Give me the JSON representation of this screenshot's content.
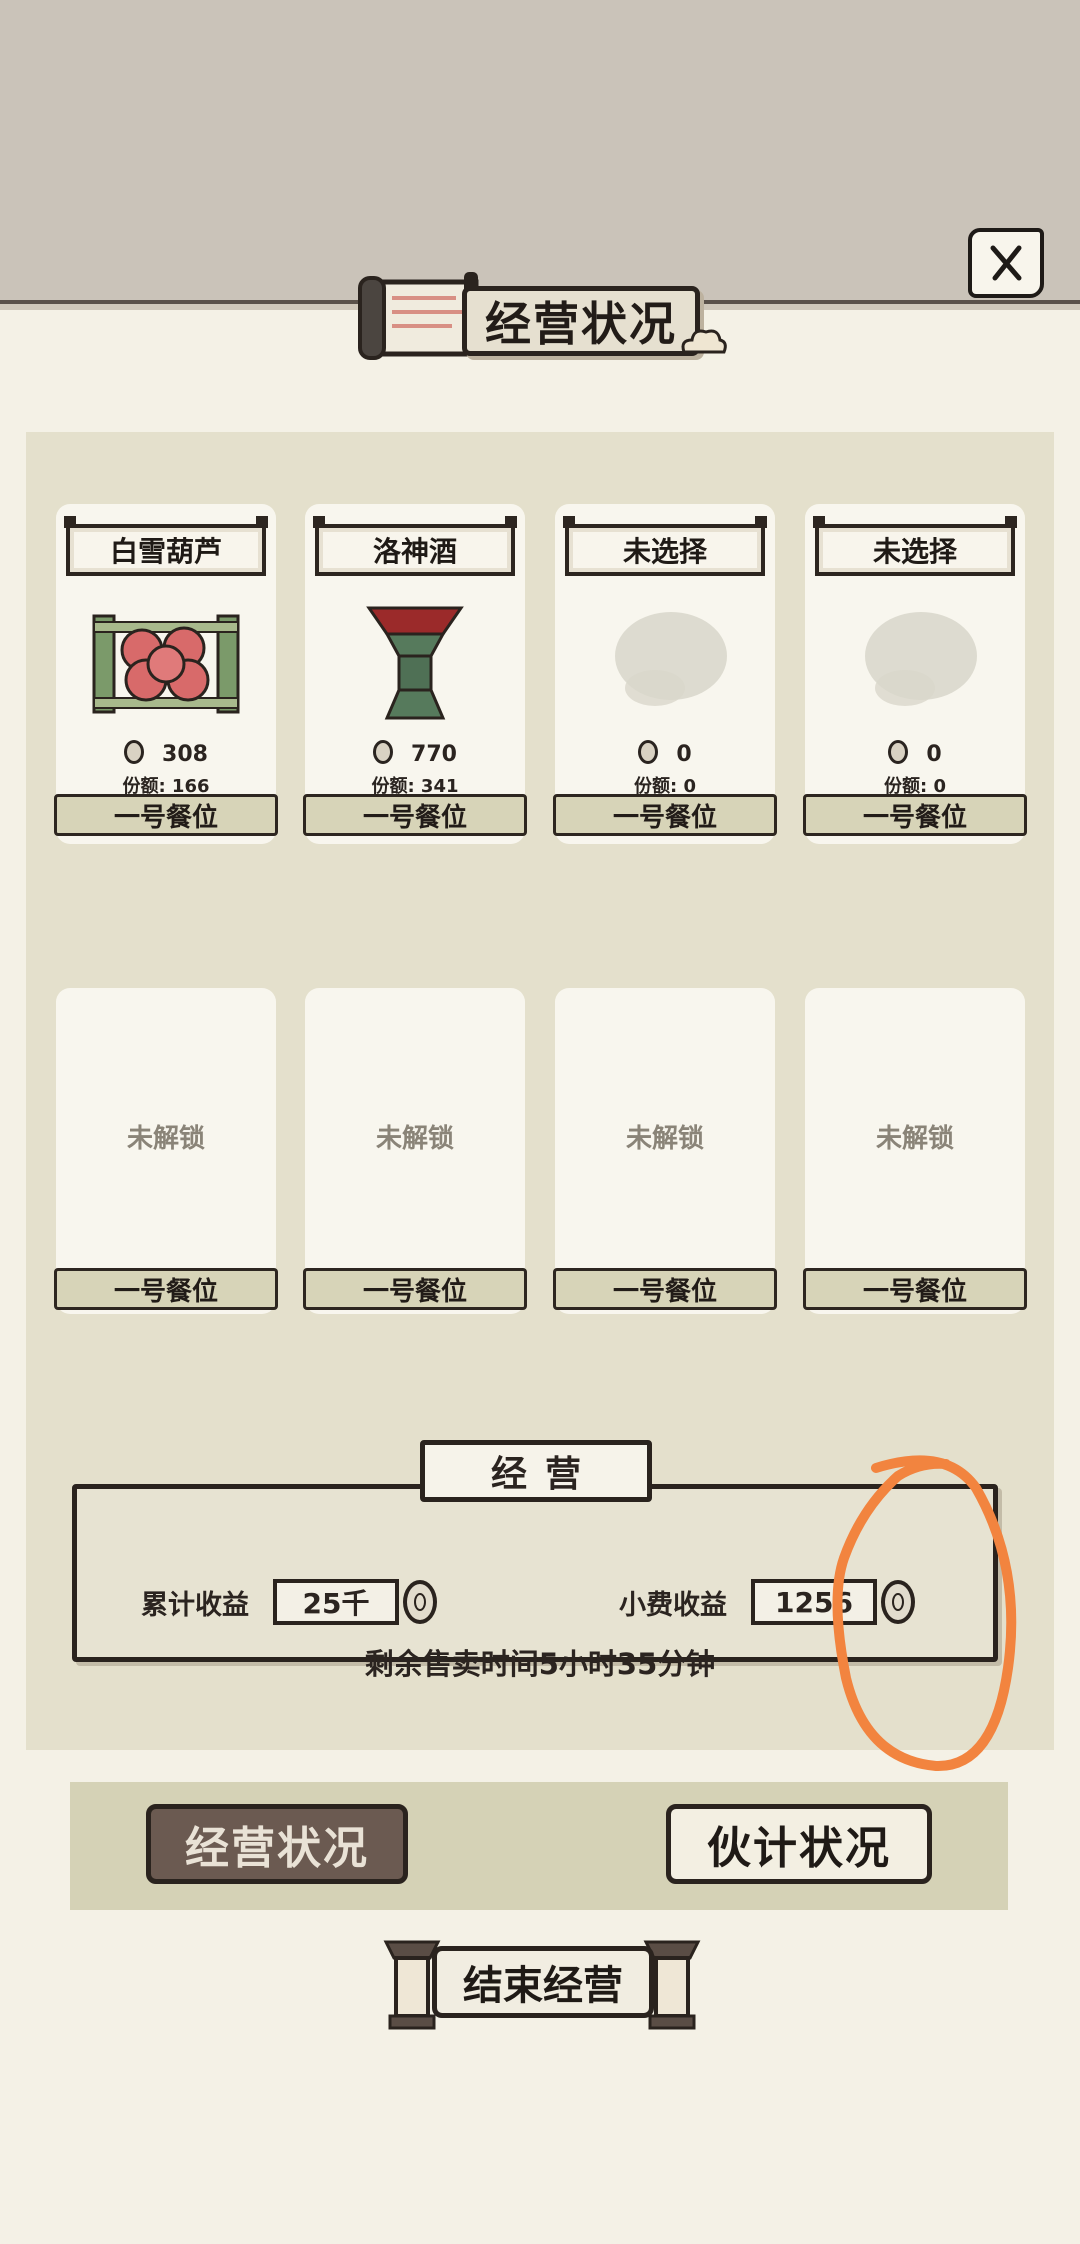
{
  "header": {
    "title": "经营状况"
  },
  "cards": [
    {
      "name": "白雪葫芦",
      "value": "308",
      "share": "份额: 166",
      "seat": "一号餐位",
      "image": "tanghulu-icon"
    },
    {
      "name": "洛神酒",
      "value": "770",
      "share": "份额: 341",
      "seat": "一号餐位",
      "image": "wine-vessel-icon"
    },
    {
      "name": "未选择",
      "value": "0",
      "share": "份额: 0",
      "seat": "一号餐位",
      "image": "ink-placeholder-icon"
    },
    {
      "name": "未选择",
      "value": "0",
      "share": "份额: 0",
      "seat": "一号餐位",
      "image": "ink-placeholder-icon"
    }
  ],
  "locked": [
    {
      "label": "未解锁",
      "seat": "一号餐位"
    },
    {
      "label": "未解锁",
      "seat": "一号餐位"
    },
    {
      "label": "未解锁",
      "seat": "一号餐位"
    },
    {
      "label": "未解锁",
      "seat": "一号餐位"
    }
  ],
  "operation": {
    "title": "经营",
    "total_label": "累计收益",
    "total_value": "25千",
    "tip_label": "小费收益",
    "tip_value": "1256",
    "remaining": "剩余售卖时间5小时35分钟"
  },
  "tabs": {
    "status": "经营状况",
    "staff": "伙计状况"
  },
  "end_button": "结束经营",
  "colors": {
    "annotation": "#f2843f",
    "active_tab": "#6b5a51",
    "panel": "#e4e0cc"
  }
}
